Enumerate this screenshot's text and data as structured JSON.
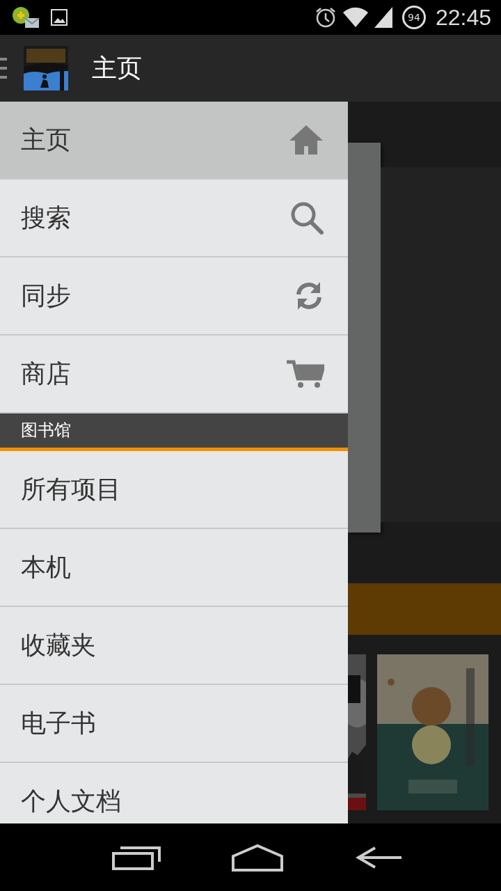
{
  "status_bar": {
    "battery": "94",
    "time": "22:45"
  },
  "app_bar": {
    "title": "主页"
  },
  "drawer": {
    "nav_items": [
      {
        "label": "主页",
        "kind": "home",
        "selected": true
      },
      {
        "label": "搜索",
        "kind": "search",
        "selected": false
      },
      {
        "label": "同步",
        "kind": "sync",
        "selected": false
      },
      {
        "label": "商店",
        "kind": "cart",
        "selected": false
      }
    ],
    "section": {
      "title": "图书馆"
    },
    "library_items": [
      {
        "label": "所有项目",
        "selected": false
      },
      {
        "label": "本机",
        "selected": false
      },
      {
        "label": "收藏夹",
        "selected": false
      },
      {
        "label": "电子书",
        "selected": false
      },
      {
        "label": "个人文档",
        "selected": false
      }
    ]
  }
}
